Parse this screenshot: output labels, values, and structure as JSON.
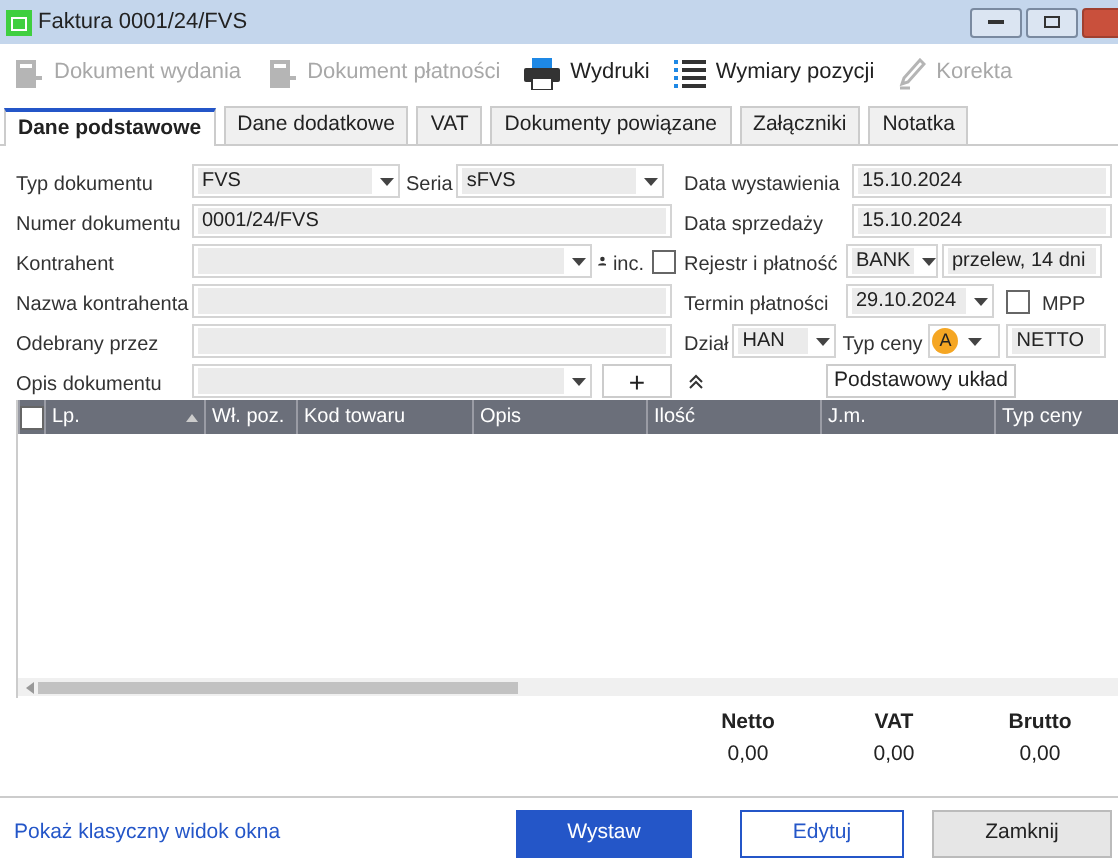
{
  "window": {
    "title": "Faktura 0001/24/FVS"
  },
  "toolbar": [
    {
      "label": "Dokument wydania",
      "kind": "doc",
      "disabled": true
    },
    {
      "label": "Dokument płatności",
      "kind": "doc",
      "disabled": true
    },
    {
      "label": "Wydruki",
      "kind": "print",
      "disabled": false
    },
    {
      "label": "Wymiary pozycji",
      "kind": "list",
      "disabled": false
    },
    {
      "label": "Korekta",
      "kind": "pen",
      "disabled": true
    }
  ],
  "tabs": [
    {
      "label": "Dane podstawowe",
      "selected": true
    },
    {
      "label": "Dane dodatkowe",
      "selected": false
    },
    {
      "label": "VAT",
      "selected": false
    },
    {
      "label": "Dokumenty powiązane",
      "selected": false
    },
    {
      "label": "Załączniki",
      "selected": false
    },
    {
      "label": "Notatka",
      "selected": false
    }
  ],
  "form": {
    "typ_dokumentu": {
      "label": "Typ dokumentu",
      "value": "FVS"
    },
    "seria": {
      "label": "Seria",
      "value": "sFVS"
    },
    "numer_dokumentu": {
      "label": "Numer dokumentu",
      "value": "0001/24/FVS"
    },
    "kontrahent": {
      "label": "Kontrahent"
    },
    "inc": {
      "label": "inc.",
      "checked": false
    },
    "nazwa_kontrahenta": {
      "label": "Nazwa kontrahenta"
    },
    "odebrany_przez": {
      "label": "Odebrany przez"
    },
    "opis_dokumentu": {
      "label": "Opis dokumentu"
    },
    "add_button": "+",
    "data_wystawienia": {
      "label": "Data wystawienia",
      "value": "15.10.2024"
    },
    "data_sprzedazy": {
      "label": "Data sprzedaży",
      "value": "15.10.2024"
    },
    "rejestr": {
      "label": "Rejestr i płatność",
      "value": "BANK",
      "payment": "przelew, 14 dni"
    },
    "termin": {
      "label": "Termin płatności",
      "value": "29.10.2024"
    },
    "mpp": {
      "label": "MPP",
      "checked": false
    },
    "dzial": {
      "label": "Dział",
      "value": "HAN"
    },
    "typ_ceny": {
      "label": "Typ ceny",
      "badge": "A",
      "value": "NETTO"
    },
    "layout": "Podstawowy układ"
  },
  "table": {
    "select_all_checked": false,
    "columns": [
      "Lp.",
      "Wł. poz.",
      "Kod towaru",
      "Opis",
      "Ilość",
      "J.m.",
      "Typ ceny"
    ]
  },
  "totals": [
    {
      "label": "Netto",
      "value": "0,00"
    },
    {
      "label": "VAT",
      "value": "0,00"
    },
    {
      "label": "Brutto",
      "value": "0,00"
    }
  ],
  "footer": {
    "link": "Pokaż klasyczny widok okna",
    "buttons": [
      {
        "label": "Wystaw",
        "kind": "primary"
      },
      {
        "label": "Edytuj",
        "kind": "outline"
      },
      {
        "label": "Zamknij",
        "kind": "plain"
      }
    ]
  }
}
